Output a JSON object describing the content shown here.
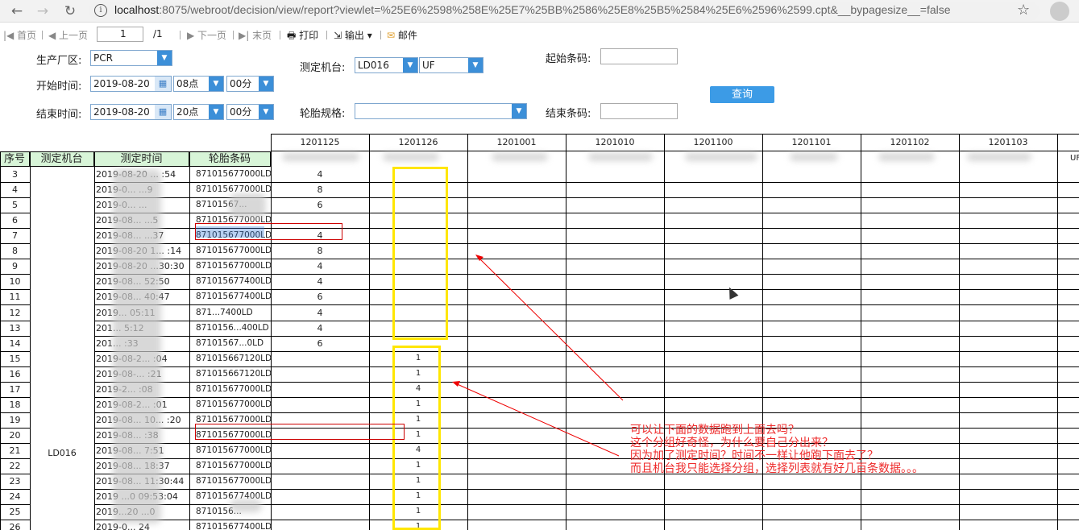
{
  "browser": {
    "url_host": "localhost",
    "url_rest": ":8075/webroot/decision/view/report?viewlet=%25E6%2598%258E%25E7%25BB%2586%25E8%25B5%2584%25E6%2596%2599.cpt&__bypagesize__=false"
  },
  "toolbar": {
    "first": "首页",
    "prev": "上一页",
    "page": "1",
    "total": "/1",
    "next": "下一页",
    "last": "末页",
    "print": "打印",
    "export": "输出",
    "mail": "邮件"
  },
  "form": {
    "plant_label": "生产厂区:",
    "plant_value": "PCR",
    "start_label": "开始时间:",
    "start_date": "2019-08-20",
    "start_hour": "08点",
    "start_min": "00分",
    "end_label": "结束时间:",
    "end_date": "2019-08-20",
    "end_hour": "20点",
    "end_min": "00分",
    "machine_label": "测定机台:",
    "machine_value": "LD016",
    "machine_group": "UF",
    "spec_label": "轮胎规格:",
    "spec_value": "",
    "start_code_label": "起始条码:",
    "end_code_label": "结束条码:",
    "query": "查询"
  },
  "table": {
    "headers": [
      "序号",
      "测定机台",
      "测定时间",
      "轮胎条码"
    ],
    "code_columns": [
      "1201125",
      "1201126",
      "1201001",
      "1201010",
      "1201100",
      "1201101",
      "1201102",
      "1201103"
    ],
    "extra_label": "UF",
    "machine": "LD016",
    "rows": [
      {
        "no": "3",
        "time": "2019-08-20 ... :54",
        "code": "871015677000LD",
        "c1": "4",
        "c2": ""
      },
      {
        "no": "4",
        "time": "2019-0... ...9",
        "code": "871015677000LD",
        "c1": "8",
        "c2": ""
      },
      {
        "no": "5",
        "time": "2019-0... ...",
        "code": "87101567...",
        "c1": "6",
        "c2": ""
      },
      {
        "no": "6",
        "time": "2019-08... ...5",
        "code": "871015677000LD",
        "c1": "",
        "c2": ""
      },
      {
        "no": "7",
        "time": "2019-08... ...37",
        "code": "871015677000LD",
        "c1": "4",
        "c2": ""
      },
      {
        "no": "8",
        "time": "2019-08-20 1... :14",
        "code": "871015677000LD",
        "c1": "8",
        "c2": ""
      },
      {
        "no": "9",
        "time": "2019-08-20 ...30:30",
        "code": "871015677000LD",
        "c1": "4",
        "c2": ""
      },
      {
        "no": "10",
        "time": "2019-08... 52:50",
        "code": "871015677400LD",
        "c1": "4",
        "c2": ""
      },
      {
        "no": "11",
        "time": "2019-08... 40:47",
        "code": "871015677400LD",
        "c1": "6",
        "c2": ""
      },
      {
        "no": "12",
        "time": "2019... 05:11",
        "code": "871...7400LD",
        "c1": "4",
        "c2": ""
      },
      {
        "no": "13",
        "time": "201... 5:12",
        "code": "8710156...400LD",
        "c1": "4",
        "c2": ""
      },
      {
        "no": "14",
        "time": "201... :33",
        "code": "87101567...0LD",
        "c1": "6",
        "c2": ""
      },
      {
        "no": "15",
        "time": "2019-08-2... :04",
        "code": "871015667120LD",
        "c1": "",
        "c2": "1"
      },
      {
        "no": "16",
        "time": "2019-08-... :21",
        "code": "871015667120LD",
        "c1": "",
        "c2": "1"
      },
      {
        "no": "17",
        "time": "2019-2... :08",
        "code": "871015677000LD",
        "c1": "",
        "c2": "4"
      },
      {
        "no": "18",
        "time": "2019-08-2... :01",
        "code": "871015677000LD",
        "c1": "",
        "c2": "1"
      },
      {
        "no": "19",
        "time": "2019-08... 10... :20",
        "code": "871015677000LD",
        "c1": "",
        "c2": "1"
      },
      {
        "no": "20",
        "time": "2019-08... :38",
        "code": "871015677000LD",
        "c1": "",
        "c2": "1"
      },
      {
        "no": "21",
        "time": "2019-08... 7:51",
        "code": "871015677000LD",
        "c1": "",
        "c2": "4"
      },
      {
        "no": "22",
        "time": "2019-08... 18:37",
        "code": "871015677000LD",
        "c1": "",
        "c2": "1"
      },
      {
        "no": "23",
        "time": "2019-08... 11:30:44",
        "code": "871015677000LD",
        "c1": "",
        "c2": "1"
      },
      {
        "no": "24",
        "time": "2019 ...0 09:53:04",
        "code": "871015677400LD",
        "c1": "",
        "c2": "1"
      },
      {
        "no": "25",
        "time": "2019...20 ...0",
        "code": "8710156...",
        "c1": "",
        "c2": "1"
      },
      {
        "no": "26",
        "time": "2019-0... 24",
        "code": "871015677400LD",
        "c1": "",
        "c2": "1"
      }
    ]
  },
  "annotation": {
    "lines": [
      "可以让下面的数据跑到上面去吗？",
      "这个分组好奇怪，为什么要自己分出来？",
      "因为加了测定时间？时间不一样让他跑下面去了？",
      "而且机台我只能选择分组，选择列表就有好几百条数据。。。"
    ],
    "color": "#ee2a2a"
  }
}
